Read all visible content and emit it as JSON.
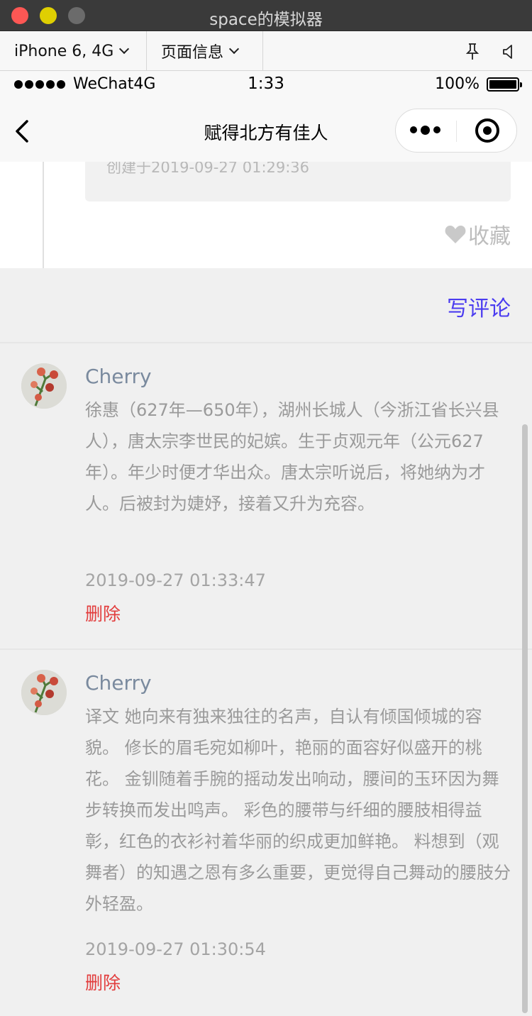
{
  "window": {
    "title": "space的模拟器"
  },
  "devtools": {
    "device": "iPhone 6, 4G",
    "page_info": "页面信息"
  },
  "statusbar": {
    "carrier": "WeChat4G",
    "time": "1:33",
    "battery": "100%"
  },
  "navbar": {
    "title": "赋得北方有佳人"
  },
  "post": {
    "created": "创建于2019-09-27 01:29:36",
    "favorite": "收藏"
  },
  "write_comment": "写评论",
  "comments": [
    {
      "name": "Cherry",
      "body": " 徐惠（627年—650年），湖州长城人（今浙江省长兴县人），唐太宗李世民的妃嫔。生于贞观元年（公元627年）。年少时便才华出众。唐太宗听说后，将她纳为才人。后被封为婕妤，接着又升为充容。",
      "time": "2019-09-27 01:33:47",
      "delete": "删除"
    },
    {
      "name": "Cherry",
      "body": " 译文 她向来有独来独往的名声，自认有倾国倾城的容貌。 修长的眉毛宛如柳叶，艳丽的面容好似盛开的桃花。 金钏随着手腕的摇动发出响动，腰间的玉环因为舞步转换而发出鸣声。 彩色的腰带与纤细的腰肢相得益彰，红色的衣衫衬着华丽的织成更加鲜艳。 料想到（观舞者）的知遇之恩有多么重要，更觉得自己舞动的腰肢分外轻盈。",
      "time": "2019-09-27 01:30:54",
      "delete": "删除"
    }
  ]
}
